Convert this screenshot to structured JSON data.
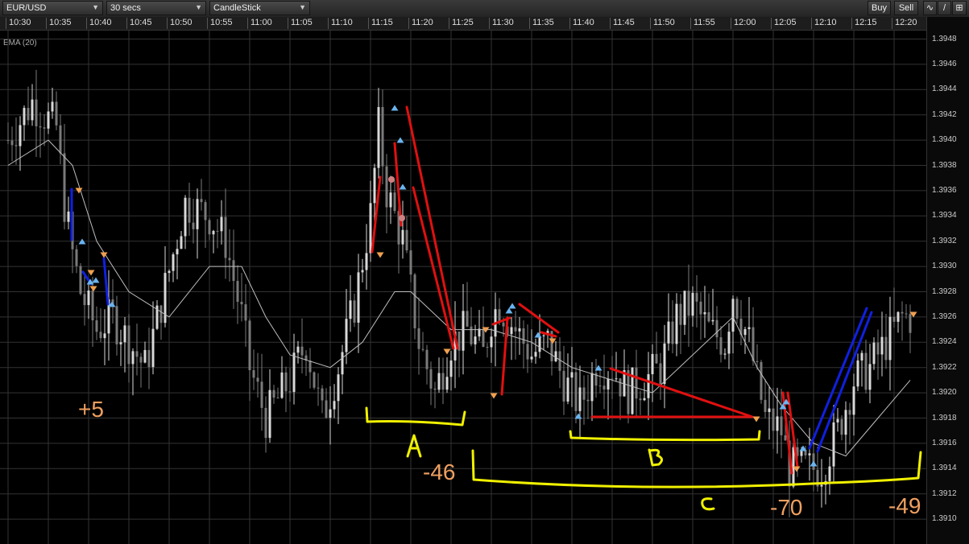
{
  "toolbar": {
    "symbol": "EUR/USD",
    "interval": "30 secs",
    "chart_type": "CandleStick",
    "buy_label": "Buy",
    "sell_label": "Sell"
  },
  "indicator_label": "EMA (20)",
  "chart_data": {
    "type": "candlestick",
    "time_labels": [
      "10:30",
      "10:35",
      "10:40",
      "10:45",
      "10:50",
      "10:55",
      "11:00",
      "11:05",
      "11:10",
      "11:15",
      "11:20",
      "11:25",
      "11:30",
      "11:35",
      "11:40",
      "11:45",
      "11:50",
      "11:55",
      "12:00",
      "12:05",
      "12:10",
      "12:15",
      "12:20"
    ],
    "price_labels": [
      "1.3948",
      "1.3946",
      "1.3944",
      "1.3942",
      "1.3940",
      "1.3938",
      "1.3936",
      "1.3934",
      "1.3932",
      "1.3930",
      "1.3928",
      "1.3926",
      "1.3924",
      "1.3922",
      "1.3920",
      "1.3918",
      "1.3916",
      "1.3914",
      "1.3912",
      "1.3910"
    ],
    "ylim": [
      1.3909,
      1.3949
    ],
    "grid": true,
    "price_path": [
      [
        "10:30",
        1.394
      ],
      [
        "10:33",
        1.3943
      ],
      [
        "10:36",
        1.3941
      ],
      [
        "10:37",
        1.3935
      ],
      [
        "10:38",
        1.3931
      ],
      [
        "10:39",
        1.3928
      ],
      [
        "10:41",
        1.3925
      ],
      [
        "10:43",
        1.3926
      ],
      [
        "10:45",
        1.3924
      ],
      [
        "10:47",
        1.3922
      ],
      [
        "10:49",
        1.3927
      ],
      [
        "10:52",
        1.3935
      ],
      [
        "10:55",
        1.3934
      ],
      [
        "10:57",
        1.3932
      ],
      [
        "10:59",
        1.3926
      ],
      [
        "11:00",
        1.3922
      ],
      [
        "11:02",
        1.3918
      ],
      [
        "11:05",
        1.3921
      ],
      [
        "11:07",
        1.3924
      ],
      [
        "11:09",
        1.3918
      ],
      [
        "11:11",
        1.3922
      ],
      [
        "11:13",
        1.3927
      ],
      [
        "11:15",
        1.3934
      ],
      [
        "11:16",
        1.3941
      ],
      [
        "11:17",
        1.3936
      ],
      [
        "11:19",
        1.3932
      ],
      [
        "11:21",
        1.3924
      ],
      [
        "11:23",
        1.392
      ],
      [
        "11:25",
        1.3924
      ],
      [
        "11:27",
        1.3925
      ],
      [
        "11:29",
        1.3923
      ],
      [
        "11:30",
        1.3926
      ],
      [
        "11:31",
        1.3927
      ],
      [
        "11:33",
        1.3925
      ],
      [
        "11:35",
        1.3923
      ],
      [
        "11:37",
        1.3924
      ],
      [
        "11:39",
        1.3921
      ],
      [
        "11:41",
        1.3919
      ],
      [
        "11:43",
        1.3922
      ],
      [
        "11:45",
        1.3922
      ],
      [
        "11:47",
        1.392
      ],
      [
        "11:49",
        1.3921
      ],
      [
        "11:51",
        1.3922
      ],
      [
        "11:53",
        1.3926
      ],
      [
        "11:55",
        1.3927
      ],
      [
        "11:57",
        1.3925
      ],
      [
        "11:59",
        1.3924
      ],
      [
        "12:00",
        1.3928
      ],
      [
        "12:02",
        1.3924
      ],
      [
        "12:04",
        1.3918
      ],
      [
        "12:06",
        1.3917
      ],
      [
        "12:07",
        1.3914
      ],
      [
        "12:09",
        1.3914
      ],
      [
        "12:11",
        1.3914
      ],
      [
        "12:13",
        1.3917
      ],
      [
        "12:15",
        1.3921
      ],
      [
        "12:17",
        1.3922
      ],
      [
        "12:19",
        1.3924
      ],
      [
        "12:21",
        1.3926
      ]
    ],
    "ema_path": [
      [
        "10:30",
        1.3938
      ],
      [
        "10:35",
        1.394
      ],
      [
        "10:38",
        1.3938
      ],
      [
        "10:41",
        1.3932
      ],
      [
        "10:45",
        1.3928
      ],
      [
        "10:50",
        1.3926
      ],
      [
        "10:55",
        1.393
      ],
      [
        "10:59",
        1.393
      ],
      [
        "11:02",
        1.3926
      ],
      [
        "11:05",
        1.3923
      ],
      [
        "11:10",
        1.3922
      ],
      [
        "11:14",
        1.3924
      ],
      [
        "11:18",
        1.3928
      ],
      [
        "11:20",
        1.3928
      ],
      [
        "11:25",
        1.3925
      ],
      [
        "11:30",
        1.3925
      ],
      [
        "11:35",
        1.3924
      ],
      [
        "11:40",
        1.3922
      ],
      [
        "11:45",
        1.3921
      ],
      [
        "11:50",
        1.392
      ],
      [
        "11:55",
        1.3923
      ],
      [
        "12:00",
        1.3926
      ],
      [
        "12:03",
        1.3922
      ],
      [
        "12:06",
        1.3919
      ],
      [
        "12:10",
        1.3916
      ],
      [
        "12:14",
        1.3915
      ],
      [
        "12:18",
        1.3918
      ],
      [
        "12:22",
        1.3921
      ]
    ],
    "annotations_text": [
      "+5",
      "-46",
      "-70",
      "-49",
      "A",
      "B",
      "C"
    ],
    "colors": {
      "up_arrow": "#6ab4f0",
      "down_arrow": "#f0a050",
      "red": "#e01010",
      "blue": "#1020e0",
      "yellow": "#f0f000",
      "orange_text": "#f0a060"
    }
  }
}
